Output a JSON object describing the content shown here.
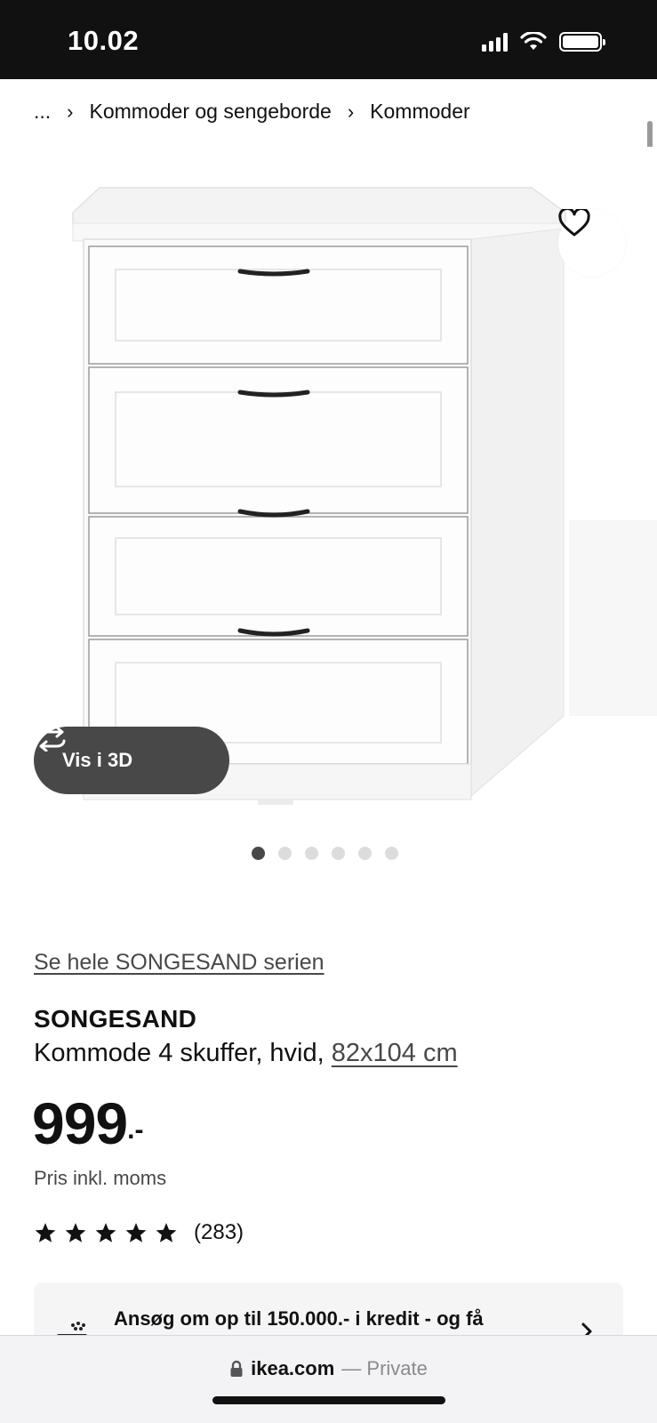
{
  "status_bar": {
    "time": "10.02"
  },
  "breadcrumb": {
    "items": [
      "...",
      "Kommoder og sengeborde",
      "Kommoder"
    ],
    "separator": "›"
  },
  "gallery": {
    "view_3d_label": "Vis i 3D",
    "image_count": 6,
    "active_index": 0
  },
  "product": {
    "series_link": "Se hele SONGESAND serien",
    "name": "SONGESAND",
    "description": "Kommode 4 skuffer, hvid,",
    "dimensions": "82x104 cm",
    "price": "999",
    "price_suffix": ".-",
    "price_note": "Pris inkl. moms",
    "rating_stars": 5,
    "review_count": "(283)"
  },
  "credit_banner": {
    "text": "Ansøg om op til 150.000.- i kredit - og få"
  },
  "browser": {
    "domain": "ikea.com",
    "mode": "— Private"
  },
  "colors": {
    "accent_dark": "#484848",
    "text": "#111111",
    "status_bar_bg": "#111111"
  },
  "icons": [
    "heart-icon",
    "rotate-3d-icon",
    "star-icon",
    "lock-icon",
    "chevron-right-icon",
    "credit-icon"
  ]
}
